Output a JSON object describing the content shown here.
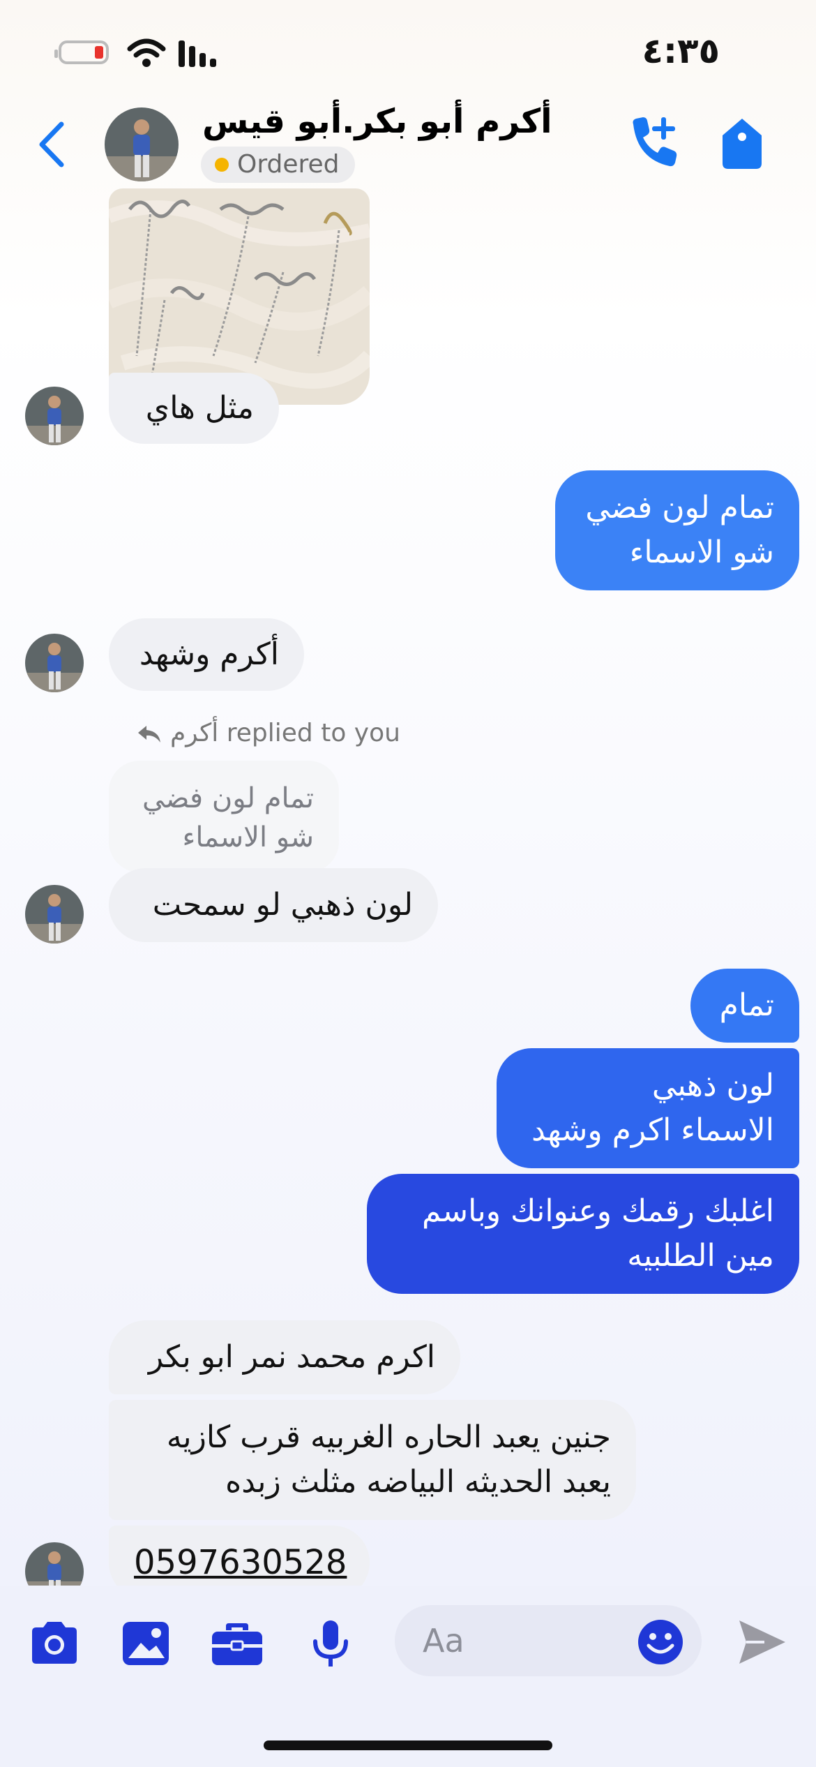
{
  "status_bar": {
    "time": "٤:٣٥",
    "battery_color": "#e8332d"
  },
  "header": {
    "contact_name": "أكرم أبو بكر.أبو قيس",
    "status_badge": "Ordered",
    "accent_color": "#1877f2"
  },
  "messages": [
    {
      "id": "m1",
      "direction": "in",
      "text": "مثل هاي"
    },
    {
      "id": "m2",
      "direction": "out",
      "lines": [
        "تمام لون فضي",
        "شو الاسماء"
      ]
    },
    {
      "id": "m3",
      "direction": "in",
      "text": "أكرم وشهد"
    },
    {
      "id": "m4",
      "direction": "in",
      "reply_note": "أكرم replied to you",
      "quoted_lines": [
        "تمام لون فضي",
        "شو الاسماء"
      ],
      "text": "لون ذهبي لو سمحت"
    },
    {
      "id": "m5",
      "direction": "out",
      "text": "تمام"
    },
    {
      "id": "m6",
      "direction": "out",
      "lines": [
        "لون ذهبي",
        "الاسماء اكرم وشهد"
      ]
    },
    {
      "id": "m7",
      "direction": "out",
      "lines": [
        "اغلبك رقمك وعنوانك وباسم",
        "مين الطلبيه"
      ]
    },
    {
      "id": "m8",
      "direction": "in",
      "text": "اكرم محمد نمر ابو بكر"
    },
    {
      "id": "m9",
      "direction": "in",
      "lines": [
        "جنين يعبد الحاره الغربيه قرب كازيه",
        "يعبد الحديثه البياضه مثلث زبده"
      ]
    },
    {
      "id": "m10",
      "direction": "in",
      "text": "0597630528"
    }
  ],
  "composer": {
    "placeholder": "Aa"
  },
  "colors": {
    "outgoing_light": "#3b82f6",
    "outgoing_dark": "#2849e0",
    "incoming": "#eff0f4",
    "icon": "#1f37d6"
  },
  "icons": [
    "back-icon",
    "call-add-icon",
    "tag-icon",
    "camera-icon",
    "image-icon",
    "briefcase-icon",
    "microphone-icon",
    "emoji-icon",
    "send-icon"
  ]
}
